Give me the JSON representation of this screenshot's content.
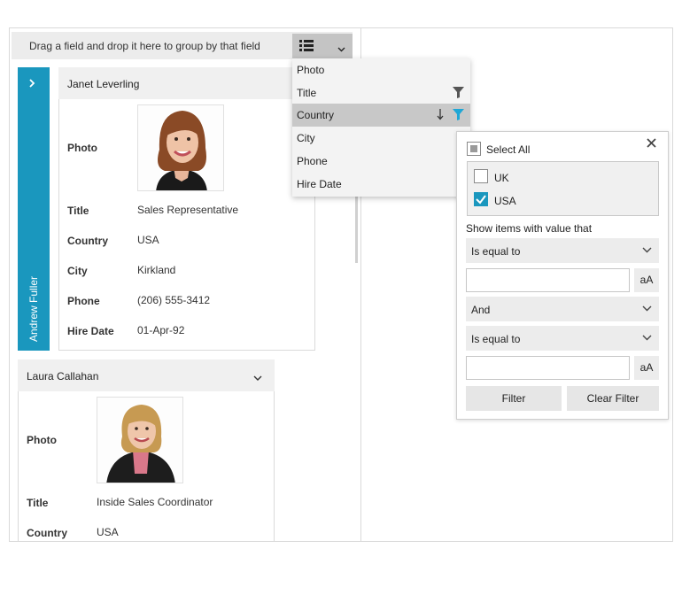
{
  "group_panel": {
    "text": "Drag a field and drop it here to group by that field"
  },
  "field_chooser": {
    "icon": "list-icon",
    "chevron": "chevron-down-icon"
  },
  "fields_menu": {
    "items": [
      {
        "label": "Photo"
      },
      {
        "label": "Title"
      },
      {
        "label": "Country"
      },
      {
        "label": "City"
      },
      {
        "label": "Phone"
      },
      {
        "label": "Hire Date"
      }
    ],
    "selected": "Country",
    "filtered_color": "#1a97be"
  },
  "cards": [
    {
      "header": "Janet  Leverling",
      "side_label": "Andrew Fuller",
      "fields": [
        {
          "label": "Photo"
        },
        {
          "label": "Title",
          "value": "Sales Representative"
        },
        {
          "label": "Country",
          "value": "USA"
        },
        {
          "label": "City",
          "value": "Kirkland"
        },
        {
          "label": "Phone",
          "value": "(206) 555-3412"
        },
        {
          "label": "Hire Date",
          "value": "01-Apr-92"
        }
      ]
    },
    {
      "header": "Laura  Callahan",
      "fields": [
        {
          "label": "Photo"
        },
        {
          "label": "Title",
          "value": "Inside Sales Coordinator"
        },
        {
          "label": "Country",
          "value": "USA"
        }
      ]
    }
  ],
  "filter": {
    "select_all": "Select All",
    "options": [
      {
        "label": "UK",
        "checked": false
      },
      {
        "label": "USA",
        "checked": true
      }
    ],
    "prompt": "Show items with value that",
    "operator1": "Is equal to",
    "logic": "And",
    "operator2": "Is equal to",
    "value1": "",
    "value2": "",
    "case_label": "aA",
    "filter_button": "Filter",
    "clear_button": "Clear Filter"
  },
  "colors": {
    "accent": "#1a97be",
    "panel": "#ececec"
  }
}
